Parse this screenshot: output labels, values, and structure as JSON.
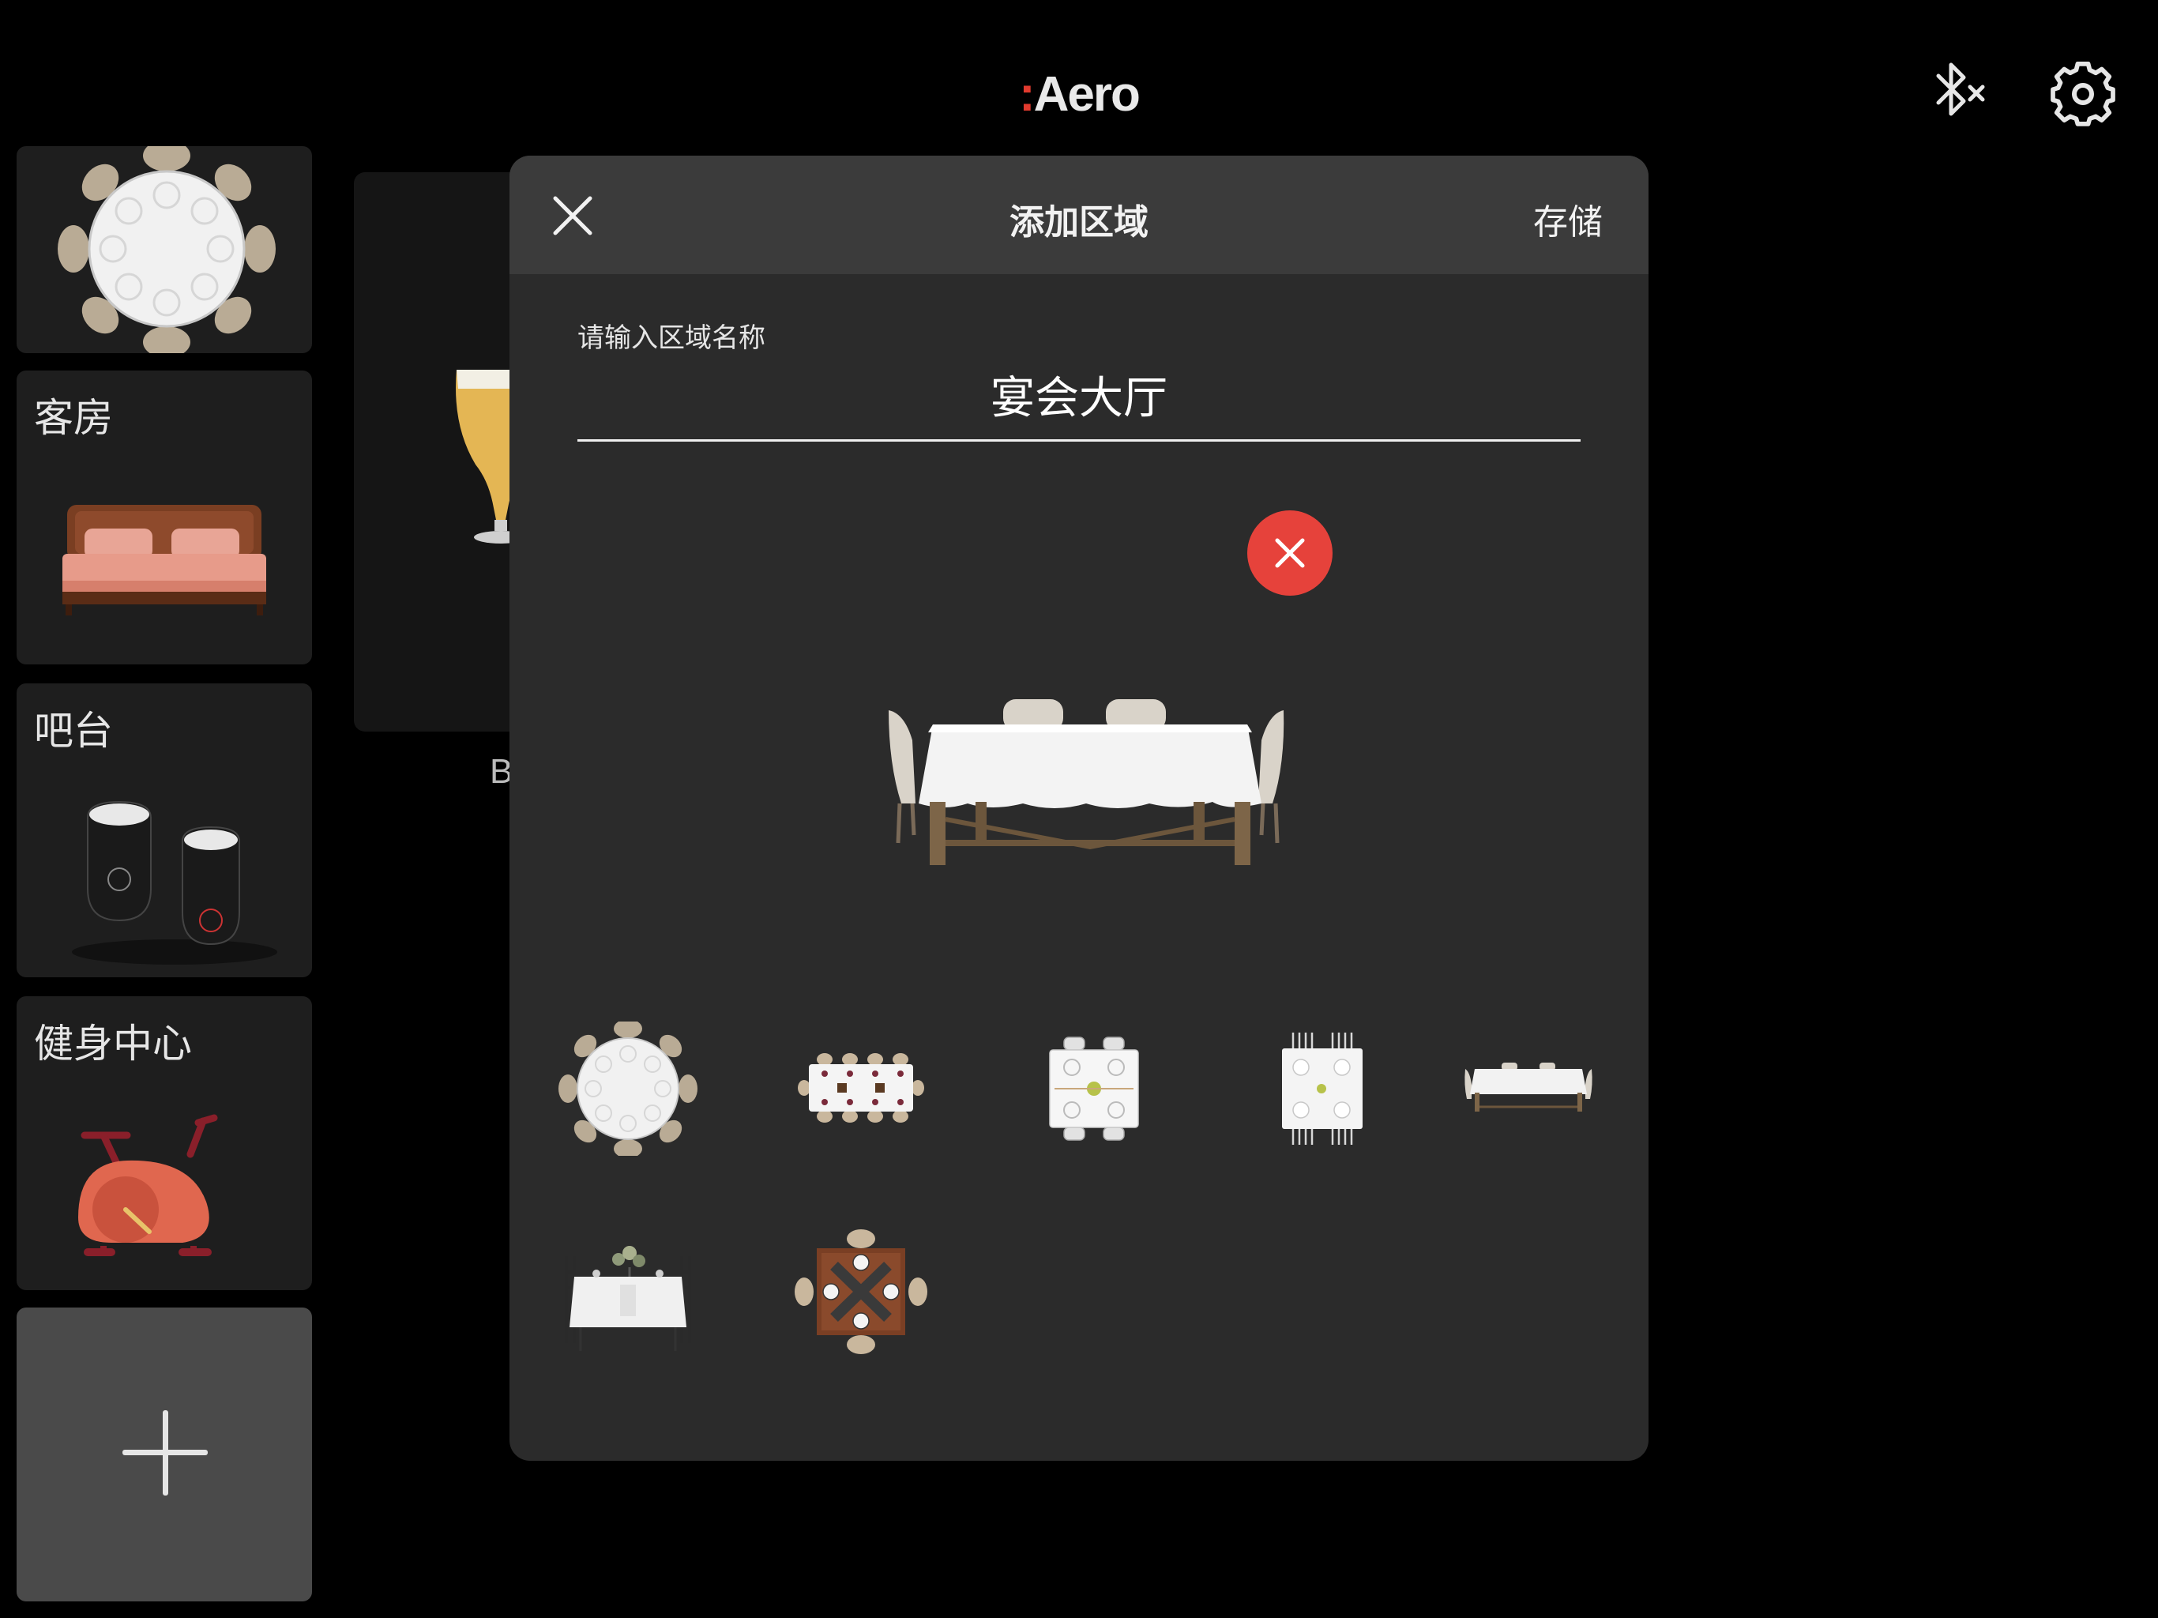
{
  "app": {
    "logo_mark": ":",
    "logo_text": "Aero"
  },
  "topbar": {
    "icons": [
      "bluetooth-off-icon",
      "gear-icon"
    ]
  },
  "sidebar": {
    "cards": [
      {
        "label": "",
        "image": "round-banquet-table"
      },
      {
        "label": "客房",
        "image": "bed"
      },
      {
        "label": "吧台",
        "image": "wine-glasses"
      },
      {
        "label": "健身中心",
        "image": "exercise-bike"
      }
    ],
    "add_label": "+"
  },
  "background": {
    "card_label": "B",
    "image": "beer-glass"
  },
  "modal": {
    "title": "添加区域",
    "close_label": "×",
    "save_label": "存储",
    "name_field": {
      "label": "请输入区域名称",
      "value": "宴会大厅"
    },
    "preview_image": "rectangular-dining-table-with-tablecloth",
    "thumbnails": [
      "round-banquet-table-top",
      "long-table-top",
      "square-table-top-flowers",
      "square-table-top-chairs",
      "rectangular-table-side",
      "dining-table-with-bouquet",
      "wooden-table-top-4-seats"
    ]
  },
  "colors": {
    "background": "#000000",
    "modal": "#2b2b2b",
    "modal_header": "#3b3b3b",
    "card": "#1e1e1e",
    "add_card": "#4a4a4a",
    "danger": "#e6423b",
    "logo_accent": "#e03a2e"
  }
}
